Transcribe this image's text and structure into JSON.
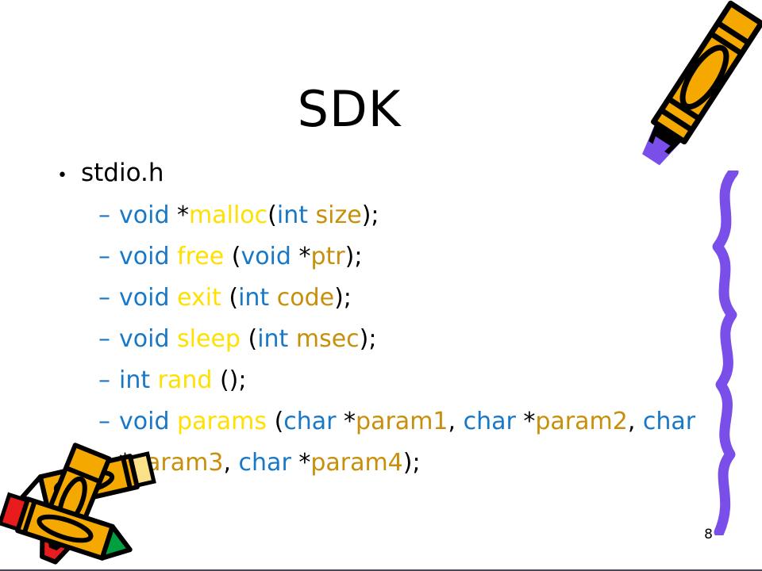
{
  "slide": {
    "title": "SDK",
    "page_number": "8",
    "background_color": "#ffffff"
  },
  "colors": {
    "keyword": "#1878c8",
    "function": "#ffe000",
    "parameter": "#c8900a",
    "punctuation": "#000000",
    "title": "#000000",
    "crayon_body": "#f5a800",
    "crayon_purple": "#7a4ee8",
    "crayon_green": "#00a040",
    "crayon_red": "#e81c1c",
    "crayon_outline": "#000000",
    "border": "#4a4a55"
  },
  "body": {
    "bullet_marker": "•",
    "dash_marker": "–",
    "items": [
      {
        "level": 1,
        "text": "stdio.h"
      }
    ],
    "code_lines": [
      {
        "name": "malloc",
        "tokens": [
          {
            "t": "void ",
            "c": "kw"
          },
          {
            "t": "*",
            "c": "pn"
          },
          {
            "t": "malloc",
            "c": "fn"
          },
          {
            "t": "(",
            "c": "pn"
          },
          {
            "t": "int ",
            "c": "kw"
          },
          {
            "t": "size",
            "c": "par"
          },
          {
            "t": ");",
            "c": "pn"
          }
        ]
      },
      {
        "name": "free",
        "tokens": [
          {
            "t": "void ",
            "c": "kw"
          },
          {
            "t": "free",
            "c": "fn"
          },
          {
            "t": " (",
            "c": "pn"
          },
          {
            "t": "void ",
            "c": "kw"
          },
          {
            "t": "*",
            "c": "pn"
          },
          {
            "t": "ptr",
            "c": "par"
          },
          {
            "t": ");",
            "c": "pn"
          }
        ]
      },
      {
        "name": "exit",
        "tokens": [
          {
            "t": "void ",
            "c": "kw"
          },
          {
            "t": "exit",
            "c": "fn"
          },
          {
            "t": " (",
            "c": "pn"
          },
          {
            "t": "int ",
            "c": "kw"
          },
          {
            "t": "code",
            "c": "par"
          },
          {
            "t": ");",
            "c": "pn"
          }
        ]
      },
      {
        "name": "sleep",
        "tokens": [
          {
            "t": "void ",
            "c": "kw"
          },
          {
            "t": "sleep",
            "c": "fn"
          },
          {
            "t": " (",
            "c": "pn"
          },
          {
            "t": "int ",
            "c": "kw"
          },
          {
            "t": "msec",
            "c": "par"
          },
          {
            "t": ");",
            "c": "pn"
          }
        ]
      },
      {
        "name": "rand",
        "tokens": [
          {
            "t": "int ",
            "c": "kw"
          },
          {
            "t": "rand",
            "c": "fn"
          },
          {
            "t": " ();",
            "c": "pn"
          }
        ]
      },
      {
        "name": "params",
        "tokens": [
          {
            "t": "void ",
            "c": "kw"
          },
          {
            "t": "params",
            "c": "fn"
          },
          {
            "t": " (",
            "c": "pn"
          },
          {
            "t": "char ",
            "c": "kw"
          },
          {
            "t": "*",
            "c": "pn"
          },
          {
            "t": "param1",
            "c": "par"
          },
          {
            "t": ", ",
            "c": "pn"
          },
          {
            "t": "char ",
            "c": "kw"
          },
          {
            "t": "*",
            "c": "pn"
          },
          {
            "t": "param2",
            "c": "par"
          },
          {
            "t": ", ",
            "c": "pn"
          },
          {
            "t": "char ",
            "c": "kw"
          },
          {
            "t": "*",
            "c": "pn"
          },
          {
            "t": "param3",
            "c": "par"
          },
          {
            "t": ", ",
            "c": "pn"
          },
          {
            "t": "char ",
            "c": "kw"
          },
          {
            "t": "*",
            "c": "pn"
          },
          {
            "t": "param4",
            "c": "par"
          },
          {
            "t": ");",
            "c": "pn"
          }
        ]
      }
    ]
  },
  "decorations": {
    "crayon_top_right": "crayon-icon",
    "squiggle_right": "squiggle-line-icon",
    "crayons_bottom_left": "crayon-cluster-icon"
  }
}
